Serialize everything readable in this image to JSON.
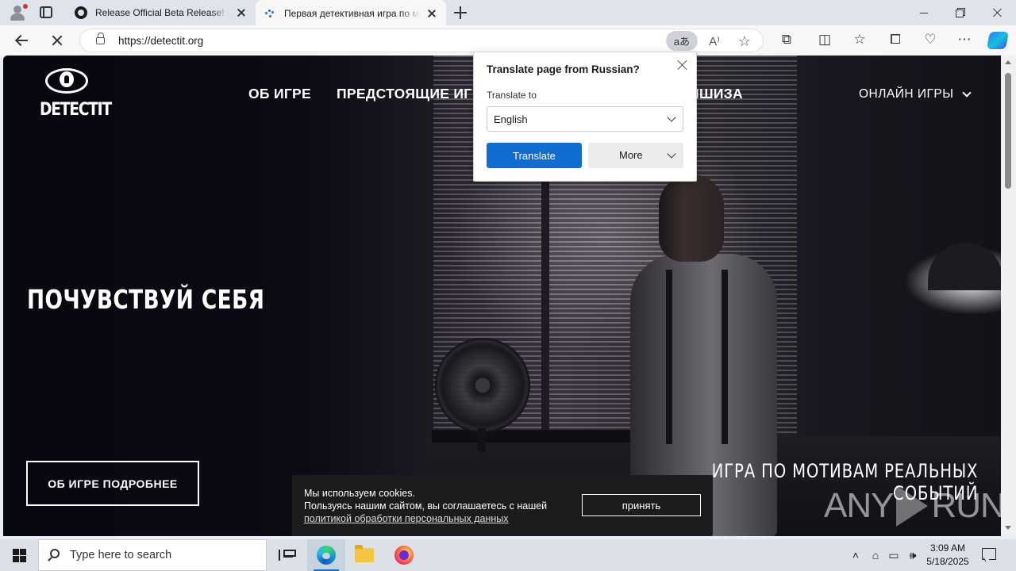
{
  "browser": {
    "tabs": [
      {
        "title": "Release Official Beta Release! · Bli",
        "favicon": "github-icon"
      },
      {
        "title": "Первая детективная игра по мо",
        "favicon": "loading-icon",
        "active": true
      }
    ],
    "url": "https://detectit.org",
    "translate_pill": "aあ"
  },
  "site": {
    "logo_text": "DETECTIT",
    "nav": [
      "ОБ ИГРЕ",
      "ПРЕДСТОЯЩИЕ ИГ",
      "НШИЗА"
    ],
    "nav_online": "ОНЛАЙН ИГРЫ",
    "hero_title": "ПОЧУВСТВУЙ СЕБЯ",
    "cta": "ОБ ИГРЕ ПОДРОБНЕЕ",
    "tagline_line1": "ИГРА ПО МОТИВАМ РЕАЛЬНЫХ",
    "tagline_line2": "СОБЫТИЙ",
    "watermark_any": "ANY",
    "watermark_run": "RUN"
  },
  "cookie": {
    "line1": "Мы используем cookies.",
    "line2": "Пользуясь нашим сайтом, вы соглашаетесь с нашей",
    "link": "политикой обработки персональных данных",
    "accept": "принять"
  },
  "translate_popup": {
    "title": "Translate page from Russian?",
    "label": "Translate to",
    "selected_language": "English",
    "translate_button": "Translate",
    "more_button": "More"
  },
  "taskbar": {
    "search_placeholder": "Type here to search",
    "time": "3:09 AM",
    "date": "5/18/2025"
  },
  "colors": {
    "translate_blue": "#0f6cd0",
    "page_dark": "#0a0a14"
  }
}
